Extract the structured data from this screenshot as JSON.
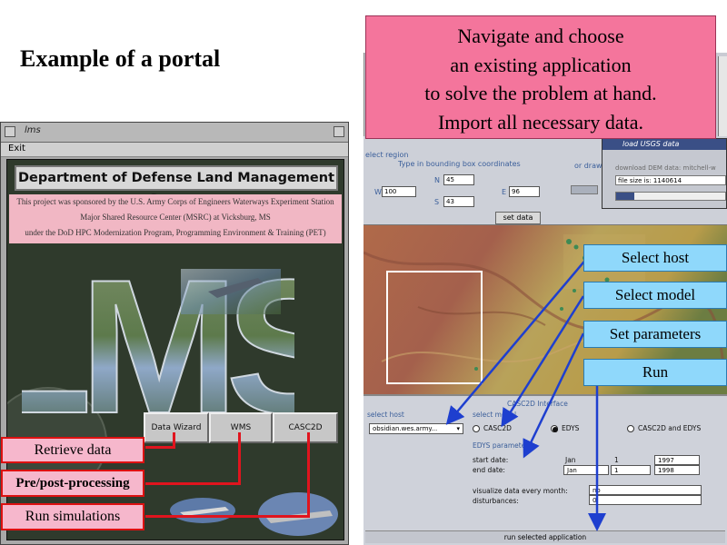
{
  "slide": {
    "title": "Example of a portal"
  },
  "callout": {
    "lines": [
      "Navigate and choose",
      "an existing application",
      "to solve the problem at hand.",
      "Import all necessary data."
    ]
  },
  "lms_window": {
    "title": "lms",
    "menu_exit": "Exit",
    "banner": "Department of Defense Land Management System",
    "sponsor_lines": [
      "This project was sponsored by the U.S. Army Corps of Engineers Waterways Experiment Station",
      "Major Shared Resource Center (MSRC) at Vicksburg, MS",
      "under the DoD HPC Modernization Program, Programming Environment & Training (PET)"
    ],
    "logo_text": "LMS",
    "buttons": [
      "Data Wizard",
      "WMS",
      "CASC2D"
    ]
  },
  "left_labels": [
    "Retrieve data",
    "Pre/post-processing",
    "Run simulations"
  ],
  "region_form": {
    "title": "elect region",
    "coords_label": "Type in bounding box coordinates",
    "draw_label": "or draw",
    "n_value": "45",
    "s_value": "43",
    "w_label": "W",
    "w_value": "100",
    "e_label": "E",
    "e_value": "96",
    "set_data": "set data"
  },
  "usgs_window": {
    "title": "load USGS data",
    "download": "download DEM data: mitchell-w",
    "file_size": "file size is: 1140614"
  },
  "casc_panel": {
    "title": "CASC2D Interface",
    "select_host_label": "select host",
    "host_value": "obsidian.wes.army...",
    "select_model_label": "select model",
    "models": [
      "CASC2D",
      "EDYS",
      "CASC2D and EDYS"
    ],
    "params_label": "EDYS parameters",
    "start_label": "start date:",
    "end_label": "end date:",
    "start_month": "Jan",
    "start_day": "1",
    "start_year": "1997",
    "end_month": "Jan",
    "end_day": "1",
    "end_year": "1998",
    "visualize_label": "visualize data every month:",
    "visualize_value": "no",
    "disturbances_label": "disturbances:",
    "disturbances_value": "0",
    "run_label": "run selected application"
  },
  "right_labels": [
    "Select host",
    "Select model",
    "Set parameters",
    "Run"
  ],
  "colors": {
    "callout": "#f4759c",
    "blue_label": "#8fd8fb",
    "red_line": "#e0141e",
    "arrow": "#1e3fcf"
  }
}
